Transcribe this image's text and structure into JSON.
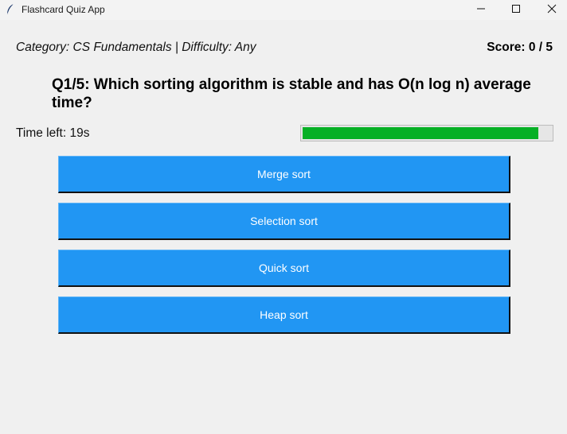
{
  "window": {
    "title": "Flashcard Quiz App",
    "icon": "feather-icon",
    "controls": [
      "minimize-icon",
      "maximize-icon",
      "close-icon"
    ]
  },
  "header": {
    "category_text": "Category: CS Fundamentals | Difficulty: Any",
    "score_text": "Score: 0 / 5"
  },
  "question": {
    "text": "Q1/5: Which sorting algorithm is stable and has O(n log n) average time?"
  },
  "timer": {
    "label": "Time left: 19s",
    "progress_fraction": 0.95,
    "progress_color": "#06b025"
  },
  "answers": [
    {
      "label": "Merge sort"
    },
    {
      "label": "Selection sort"
    },
    {
      "label": "Quick sort"
    },
    {
      "label": "Heap sort"
    }
  ],
  "colors": {
    "answer_button": "#2196f3",
    "answer_text": "#ffffff",
    "background": "#f0f0f0"
  }
}
